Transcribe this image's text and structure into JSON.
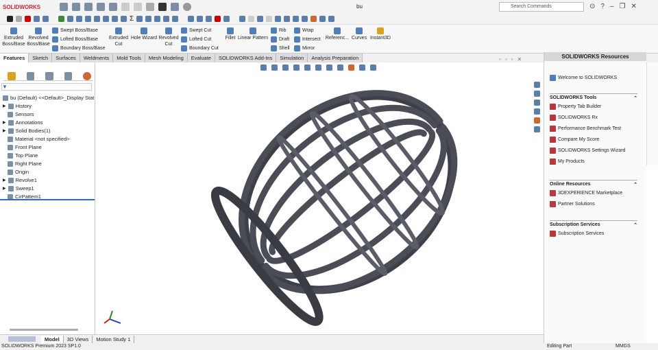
{
  "app": {
    "logo": "SOLIDWORKS",
    "doc_title": "bu",
    "search_placeholder": "Search Commands"
  },
  "ribbon": {
    "big": [
      {
        "label": "Extruded\nBoss/Base"
      },
      {
        "label": "Revolved\nBoss/Base"
      },
      {
        "label": "Extruded\nCut"
      },
      {
        "label": "Hole Wizard"
      },
      {
        "label": "Revolved\nCut"
      },
      {
        "label": "Fillet"
      },
      {
        "label": "Linear Pattern"
      },
      {
        "label": "Referenc..."
      },
      {
        "label": "Curves"
      },
      {
        "label": "Instant3D"
      }
    ],
    "small": [
      "Swept Boss/Base",
      "Lofted Boss/Base",
      "Boundary Boss/Base",
      "Swept Cut",
      "Lofted Cut",
      "Boundary Cut",
      "Rib",
      "Draft",
      "Shell",
      "Wrap",
      "Intersect",
      "Mirror"
    ]
  },
  "tabs": [
    "Features",
    "Sketch",
    "Surfaces",
    "Weldments",
    "Mold Tools",
    "Mesh Modeling",
    "Evaluate",
    "SOLIDWORKS Add-Ins",
    "Simulation",
    "Analysis Preparation"
  ],
  "tree": [
    "bu (Default) <<Default>_Display Stat",
    "History",
    "Sensors",
    "Annotations",
    "Solid Bodies(1)",
    "Material <not specified>",
    "Front Plane",
    "Top Plane",
    "Right Plane",
    "Origin",
    "Revolve1",
    "Sweep1",
    "CirPattern1"
  ],
  "taskpane": {
    "title": "SOLIDWORKS Resources",
    "welcome": "Welcome to SOLIDWORKS",
    "sections": [
      {
        "title": "SOLIDWORKS Tools",
        "items": [
          "Property Tab Builder",
          "SOLIDWORKS Rx",
          "Performance Benchmark Test",
          "Compare My Score",
          "SOLIDWORKS Settings Wizard",
          "My Products"
        ]
      },
      {
        "title": "Online Resources",
        "items": [
          "3DEXPERIENCE Marketplace",
          "Partner Solutions"
        ]
      },
      {
        "title": "Subscription Services",
        "items": [
          "Subscription Services"
        ]
      }
    ]
  },
  "bottom_tabs": [
    "Model",
    "3D Views",
    "Motion Study 1"
  ],
  "status": {
    "version": "SOLIDWORKS Premium 2023 SP1.0",
    "mode": "Editing Part",
    "units": "MMGS"
  }
}
